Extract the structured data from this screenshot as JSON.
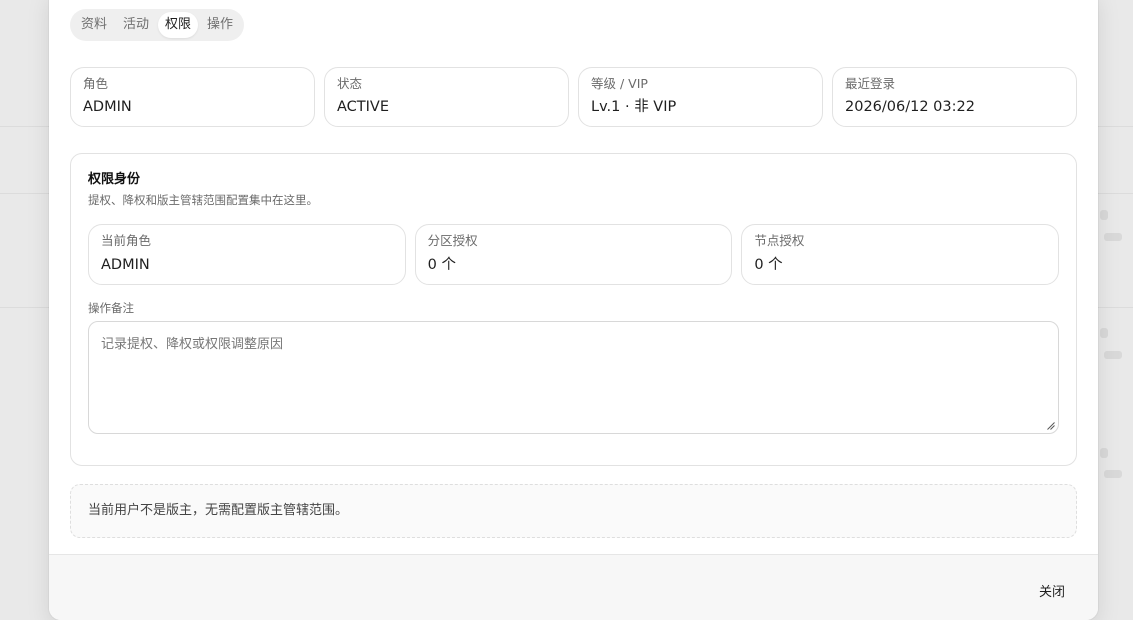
{
  "tabs": [
    {
      "label": "资料"
    },
    {
      "label": "活动"
    },
    {
      "label": "权限"
    },
    {
      "label": "操作"
    }
  ],
  "active_tab": "权限",
  "stats": [
    {
      "label": "角色",
      "value": "ADMIN"
    },
    {
      "label": "状态",
      "value": "ACTIVE"
    },
    {
      "label": "等级 / VIP",
      "value": "Lv.1 · 非 VIP"
    },
    {
      "label": "最近登录",
      "value": "2026/06/12 03:22"
    }
  ],
  "permission_card": {
    "title": "权限身份",
    "description": "提权、降权和版主管辖范围配置集中在这里。",
    "items": [
      {
        "label": "当前角色",
        "value": "ADMIN"
      },
      {
        "label": "分区授权",
        "value": "0 个"
      },
      {
        "label": "节点授权",
        "value": "0 个"
      }
    ],
    "note_label": "操作备注",
    "note_placeholder": "记录提权、降权或权限调整原因",
    "note_value": ""
  },
  "notice": "当前用户不是版主，无需配置版主管辖范围。",
  "footer": {
    "close_label": "关闭"
  }
}
